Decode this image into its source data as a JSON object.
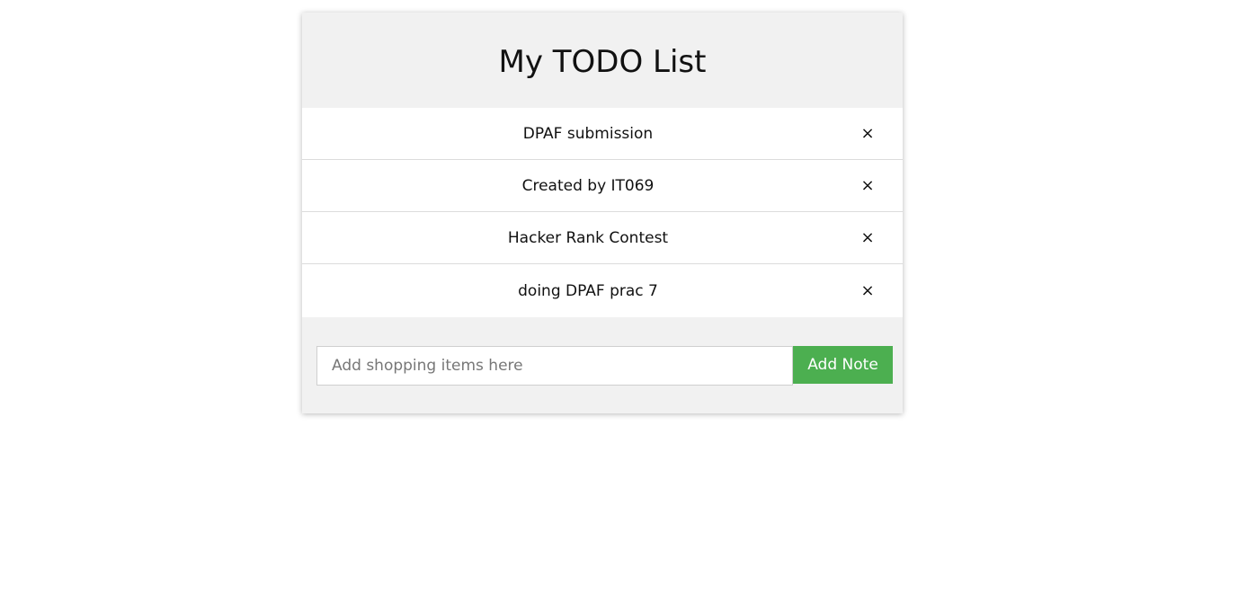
{
  "app": {
    "title": "My TODO List"
  },
  "todos": [
    {
      "text": "DPAF submission",
      "remove_label": "×"
    },
    {
      "text": "Created by IT069",
      "remove_label": "×"
    },
    {
      "text": "Hacker Rank Contest",
      "remove_label": "×"
    },
    {
      "text": "doing DPAF prac 7",
      "remove_label": "×"
    }
  ],
  "add_form": {
    "input_value": "",
    "placeholder": "Add shopping items here",
    "button_label": "Add Note"
  },
  "colors": {
    "card_background": "#f1f1f1",
    "list_background": "#ffffff",
    "accent_green": "#4caf50"
  }
}
